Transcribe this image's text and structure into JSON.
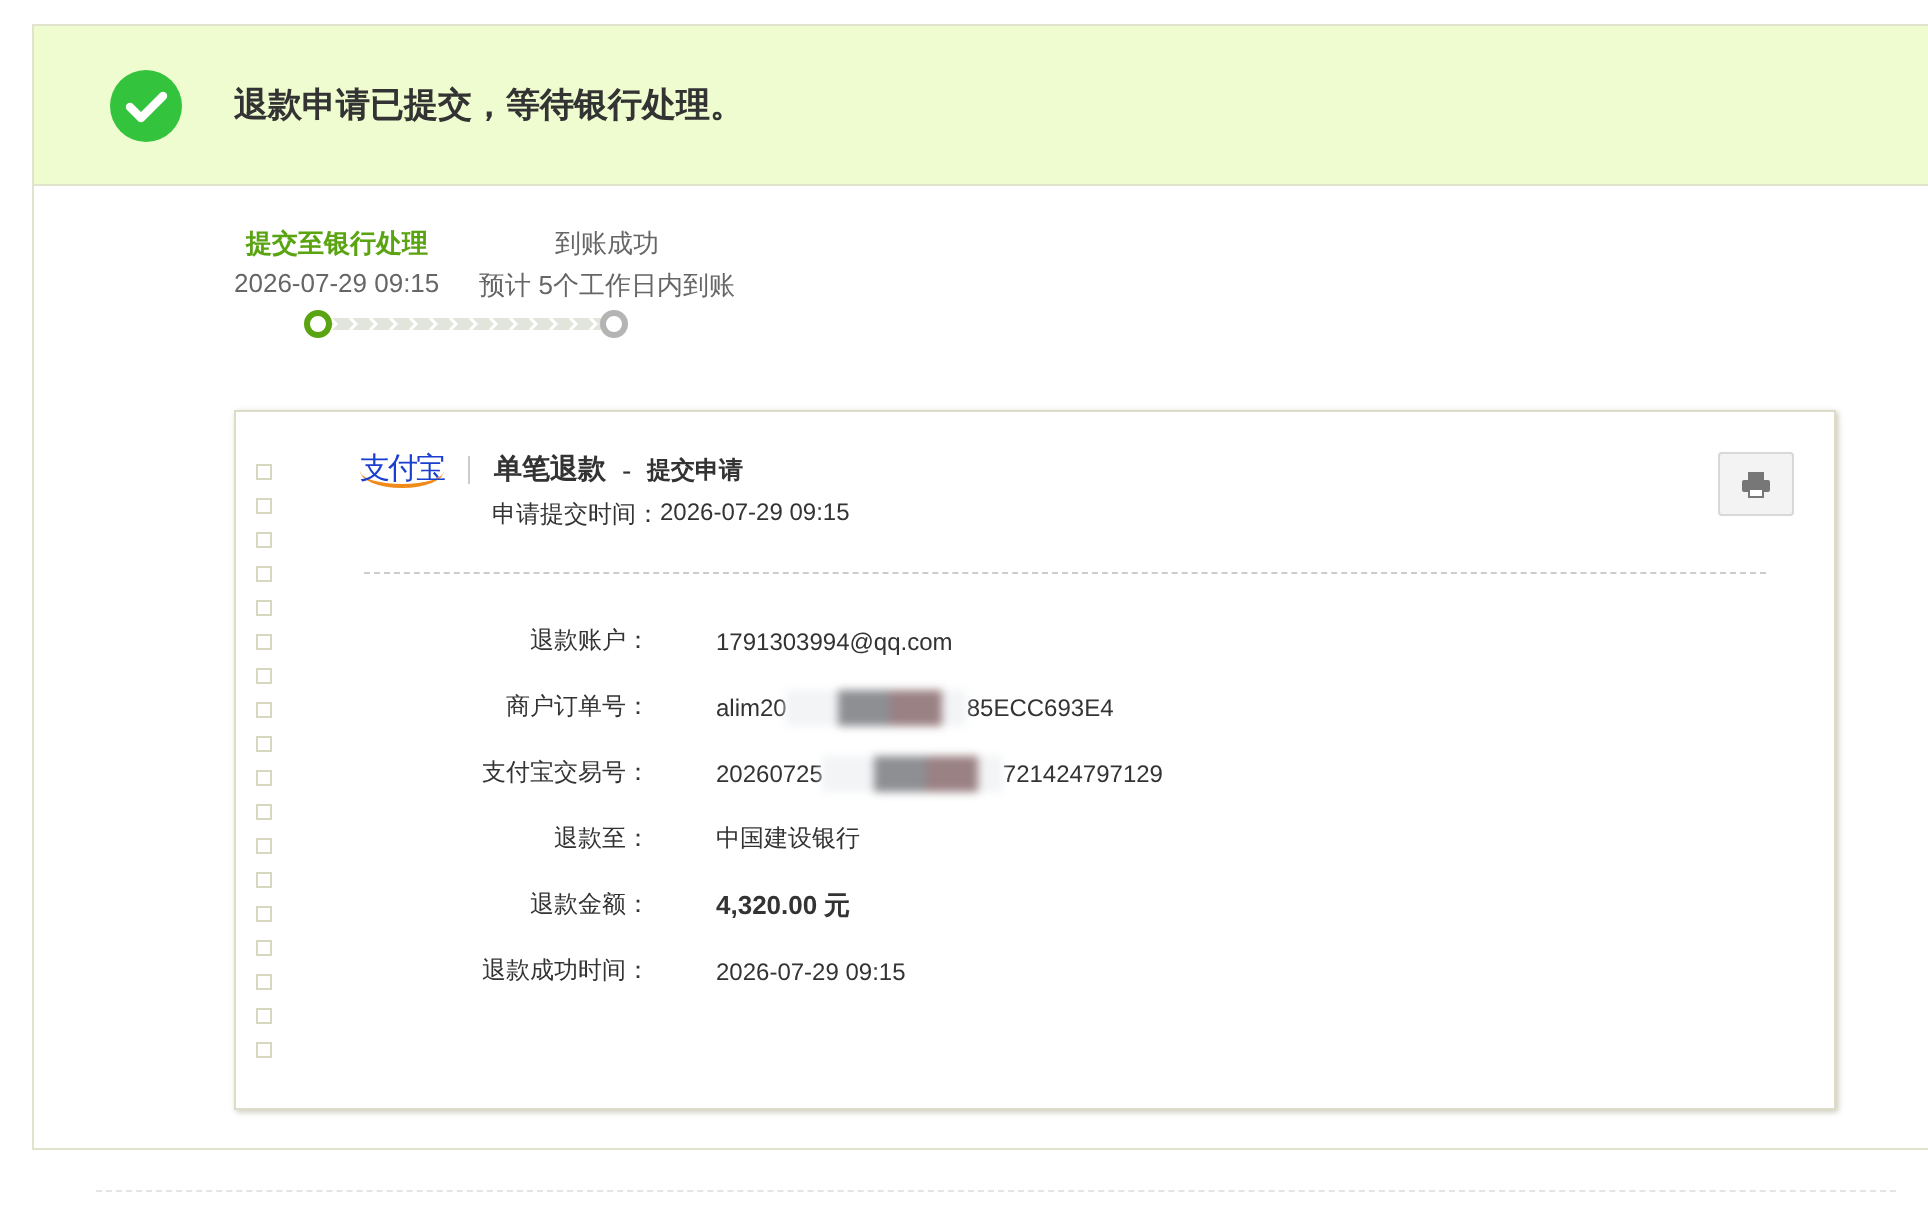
{
  "banner": {
    "message": "退款申请已提交，等待银行处理。"
  },
  "steps": [
    {
      "title": "提交至银行处理",
      "subtitle": "2026-07-29 09:15",
      "selected": true
    },
    {
      "title": "到账成功",
      "subtitle": "预计 5个工作日内到账",
      "selected": false
    }
  ],
  "receipt": {
    "logo": "支付宝",
    "title": "单笔退款",
    "separator": "-",
    "stage": "提交申请",
    "submitted_label": "申请提交时间：",
    "submitted_time": "2026-07-29 09:15",
    "rows": [
      {
        "label": "退款账户：",
        "value_parts": [
          "1791303994@qq.com"
        ],
        "bold": false
      },
      {
        "label": "商户订单号：",
        "value_parts": [
          "alim20",
          "85ECC693E4"
        ],
        "bold": false
      },
      {
        "label": "支付宝交易号：",
        "value_parts": [
          "20260725",
          "721424797129"
        ],
        "bold": false
      },
      {
        "label": "退款至：",
        "value_parts": [
          "中国建设银行"
        ],
        "bold": false
      },
      {
        "label": "退款金额：",
        "value_parts": [
          "4,320.00 元"
        ],
        "bold": true
      },
      {
        "label": "退款成功时间：",
        "value_parts": [
          "2026-07-29 09:15"
        ],
        "bold": false
      }
    ]
  }
}
